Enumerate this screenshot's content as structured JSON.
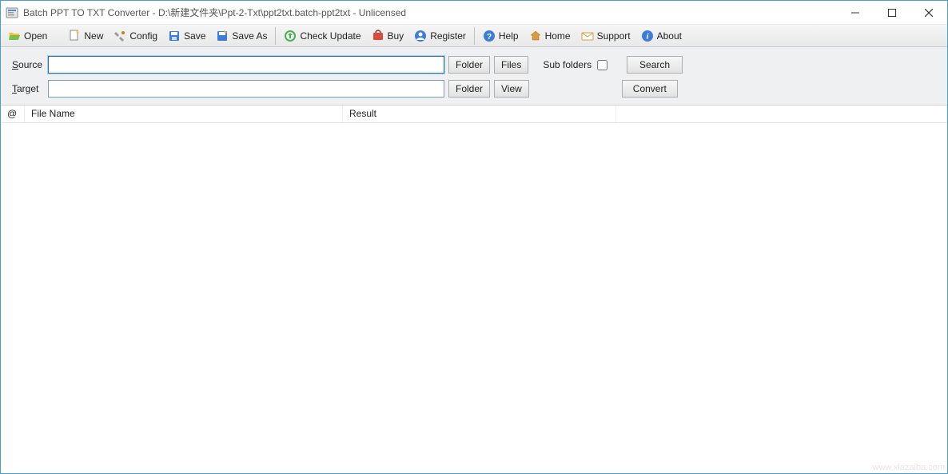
{
  "window": {
    "title": "Batch PPT TO TXT Converter - D:\\新建文件夹\\Ppt-2-Txt\\ppt2txt.batch-ppt2txt - Unlicensed"
  },
  "toolbar": {
    "open": "Open",
    "new": "New",
    "config": "Config",
    "save": "Save",
    "save_as": "Save As",
    "check_update": "Check Update",
    "buy": "Buy",
    "register": "Register",
    "help": "Help",
    "home": "Home",
    "support": "Support",
    "about": "About"
  },
  "form": {
    "source_label_pre": "S",
    "source_label_rest": "ource",
    "target_label_pre": "T",
    "target_label_rest": "arget",
    "source_value": "",
    "target_value": "",
    "folder_btn": "Folder",
    "files_btn": "Files",
    "view_btn": "View",
    "sub_folders_label": "Sub folders",
    "search_btn": "Search",
    "convert_btn": "Convert"
  },
  "grid": {
    "col_at": "@",
    "col_filename": "File Name",
    "col_result": "Result"
  },
  "watermark": "www.xiazaiba.com"
}
